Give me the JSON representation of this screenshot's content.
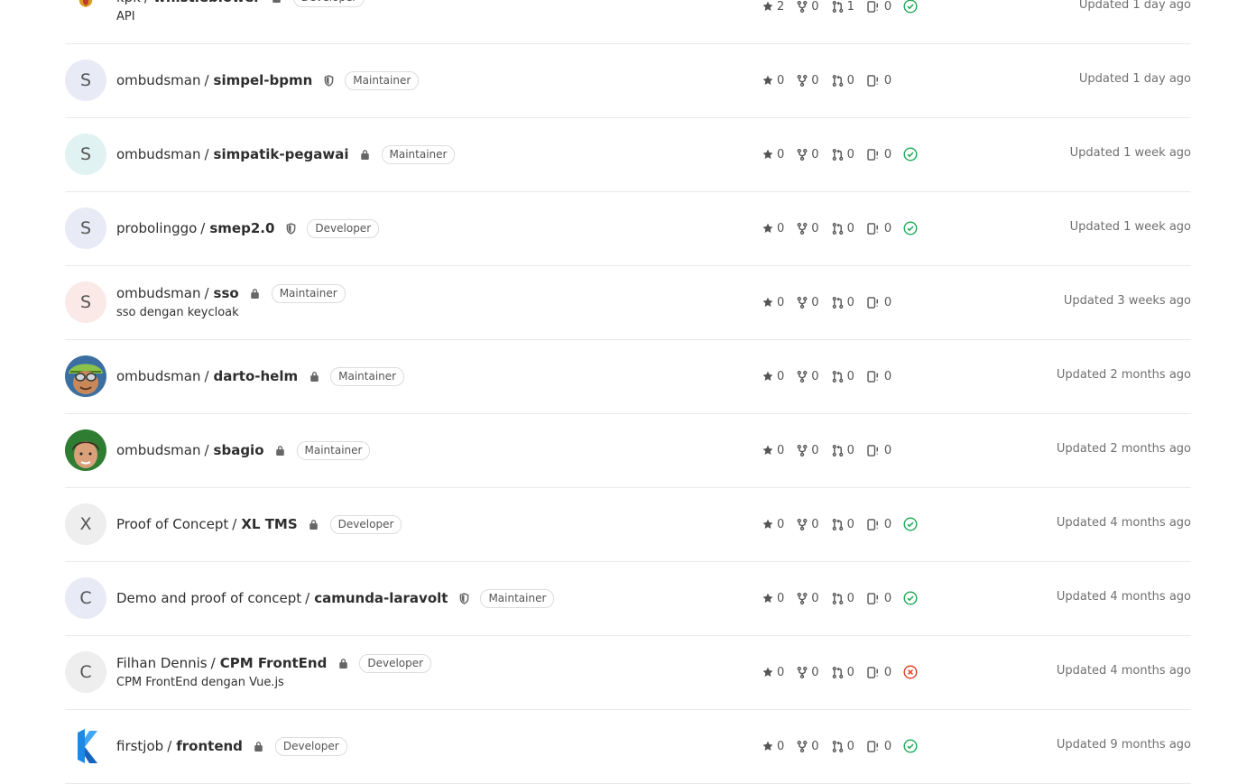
{
  "projects": [
    {
      "namespace": "kpk",
      "project": "whistleblower",
      "visibility": "lock",
      "role": "Developer",
      "description": "API",
      "stars": "2",
      "forks": "0",
      "merge_requests": "1",
      "issues": "0",
      "pipeline": "success",
      "updated": "Updated 1 day ago",
      "avatar": {
        "type": "image",
        "icon": "kpk-logo-icon",
        "text": "KPK"
      }
    },
    {
      "namespace": "ombudsman",
      "project": "simpel-bpmn",
      "visibility": "shield",
      "role": "Maintainer",
      "description": "",
      "stars": "0",
      "forks": "0",
      "merge_requests": "0",
      "issues": "0",
      "pipeline": "none",
      "updated": "Updated 1 day ago",
      "avatar": {
        "type": "letter",
        "letter": "S",
        "color": "purple"
      }
    },
    {
      "namespace": "ombudsman",
      "project": "simpatik-pegawai",
      "visibility": "lock",
      "role": "Maintainer",
      "description": "",
      "stars": "0",
      "forks": "0",
      "merge_requests": "0",
      "issues": "0",
      "pipeline": "success",
      "updated": "Updated 1 week ago",
      "avatar": {
        "type": "letter",
        "letter": "S",
        "color": "teal"
      }
    },
    {
      "namespace": "probolinggo",
      "project": "smep2.0",
      "visibility": "shield",
      "role": "Developer",
      "description": "",
      "stars": "0",
      "forks": "0",
      "merge_requests": "0",
      "issues": "0",
      "pipeline": "success",
      "updated": "Updated 1 week ago",
      "avatar": {
        "type": "letter",
        "letter": "S",
        "color": "purple"
      }
    },
    {
      "namespace": "ombudsman",
      "project": "sso",
      "visibility": "lock",
      "role": "Maintainer",
      "description": "sso dengan keycloak",
      "stars": "0",
      "forks": "0",
      "merge_requests": "0",
      "issues": "0",
      "pipeline": "none",
      "updated": "Updated 3 weeks ago",
      "avatar": {
        "type": "letter",
        "letter": "S",
        "color": "red"
      }
    },
    {
      "namespace": "ombudsman",
      "project": "darto-helm",
      "visibility": "lock",
      "role": "Maintainer",
      "description": "",
      "stars": "0",
      "forks": "0",
      "merge_requests": "0",
      "issues": "0",
      "pipeline": "none",
      "updated": "Updated 2 months ago",
      "avatar": {
        "type": "image",
        "icon": "user-photo-icon"
      }
    },
    {
      "namespace": "ombudsman",
      "project": "sbagio",
      "visibility": "lock",
      "role": "Maintainer",
      "description": "",
      "stars": "0",
      "forks": "0",
      "merge_requests": "0",
      "issues": "0",
      "pipeline": "none",
      "updated": "Updated 2 months ago",
      "avatar": {
        "type": "image",
        "icon": "user-photo-icon"
      }
    },
    {
      "namespace": "Proof of Concept",
      "project": "XL TMS",
      "visibility": "lock",
      "role": "Developer",
      "description": "",
      "stars": "0",
      "forks": "0",
      "merge_requests": "0",
      "issues": "0",
      "pipeline": "success",
      "updated": "Updated 4 months ago",
      "avatar": {
        "type": "letter",
        "letter": "X",
        "color": "gray"
      }
    },
    {
      "namespace": "Demo and proof of concept",
      "project": "camunda-laravolt",
      "visibility": "shield",
      "role": "Maintainer",
      "description": "",
      "stars": "0",
      "forks": "0",
      "merge_requests": "0",
      "issues": "0",
      "pipeline": "success",
      "updated": "Updated 4 months ago",
      "avatar": {
        "type": "letter",
        "letter": "C",
        "color": "purple"
      }
    },
    {
      "namespace": "Filhan Dennis",
      "project": "CPM FrontEnd",
      "visibility": "lock",
      "role": "Developer",
      "description": "CPM FrontEnd dengan Vue.js",
      "stars": "0",
      "forks": "0",
      "merge_requests": "0",
      "issues": "0",
      "pipeline": "failed",
      "updated": "Updated 4 months ago",
      "avatar": {
        "type": "letter",
        "letter": "C",
        "color": "gray"
      }
    },
    {
      "namespace": "firstjob",
      "project": "frontend",
      "visibility": "lock",
      "role": "Developer",
      "description": "",
      "stars": "0",
      "forks": "0",
      "merge_requests": "0",
      "issues": "0",
      "pipeline": "success",
      "updated": "Updated 9 months ago",
      "avatar": {
        "type": "image",
        "icon": "firstjob-logo-icon"
      }
    }
  ],
  "colors": {
    "success": "#1aaa55",
    "failed": "#db3b21",
    "icon": "#555555"
  }
}
